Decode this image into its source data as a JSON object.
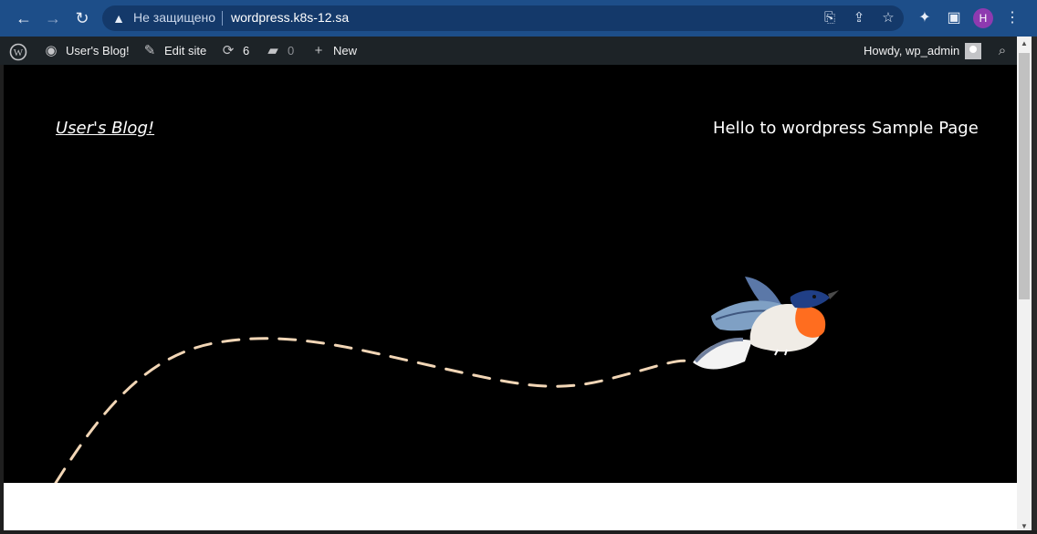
{
  "browser": {
    "address_status": "Не защищено",
    "url": "wordpress.k8s-12.sa",
    "profile_initial": "H"
  },
  "admin_bar": {
    "site_name": "User's Blog!",
    "edit_site": "Edit site",
    "updates_count": "6",
    "comments_count": "0",
    "new_label": "New",
    "howdy": "Howdy, wp_admin"
  },
  "site": {
    "title": "User's Blog!",
    "menu": [
      "Hello to wordpress",
      "Sample Page"
    ]
  },
  "colors": {
    "chrome_bar": "#1d4e89",
    "admin_bar": "#1d2327",
    "hero_background": "#000000",
    "dash_path": "#f2d6b6"
  }
}
